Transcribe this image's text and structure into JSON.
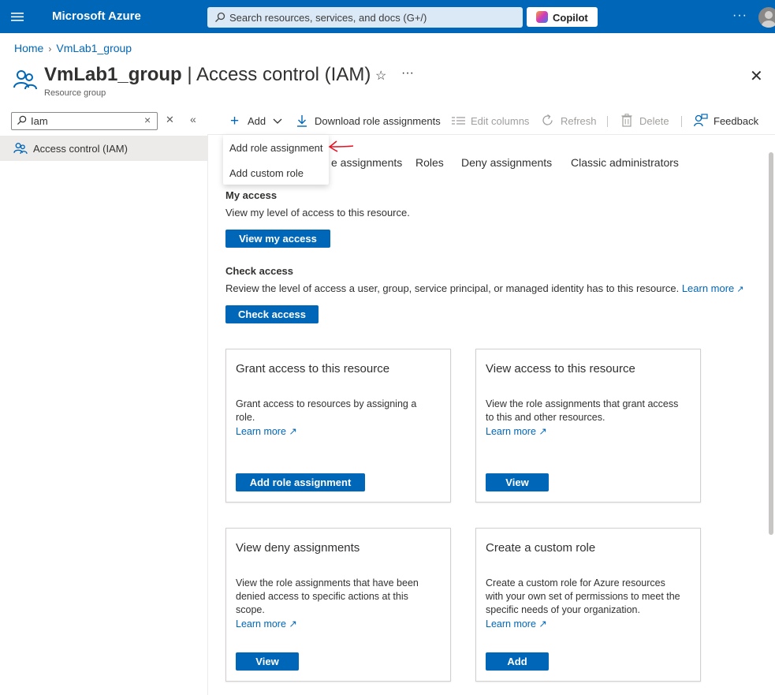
{
  "topbar": {
    "brand": "Microsoft Azure",
    "search_placeholder": "Search resources, services, and docs (G+/)",
    "copilot_label": "Copilot",
    "more": "···"
  },
  "breadcrumb": [
    "Home",
    "VmLab1_group"
  ],
  "page": {
    "resource": "VmLab1_group",
    "section": "Access control (IAM)",
    "separator": "|",
    "subtitle": "Resource group"
  },
  "sidebar": {
    "search_value": "Iam",
    "items": [
      {
        "label": "Access control (IAM)"
      }
    ]
  },
  "toolbar": {
    "add": "Add",
    "download": "Download role assignments",
    "edit_columns": "Edit columns",
    "refresh": "Refresh",
    "delete": "Delete",
    "feedback": "Feedback"
  },
  "dropdown": {
    "items": [
      "Add role assignment",
      "Add custom role"
    ]
  },
  "tabs": {
    "partial": "e assignments",
    "roles": "Roles",
    "deny": "Deny assignments",
    "classic": "Classic administrators"
  },
  "my_access": {
    "title": "My access",
    "desc": "View my level of access to this resource.",
    "button": "View my access"
  },
  "check_access": {
    "title": "Check access",
    "desc": "Review the level of access a user, group, service principal, or managed identity has to this resource.",
    "link": "Learn more",
    "button": "Check access"
  },
  "cards": [
    {
      "title": "Grant access to this resource",
      "desc": "Grant access to resources by assigning a role.",
      "link": "Learn more",
      "button": "Add role assignment"
    },
    {
      "title": "View access to this resource",
      "desc": "View the role assignments that grant access to this and other resources.",
      "link": "Learn more",
      "button": "View"
    },
    {
      "title": "View deny assignments",
      "desc": "View the role assignments that have been denied access to specific actions at this scope.",
      "link": "Learn more",
      "button": "View"
    },
    {
      "title": "Create a custom role",
      "desc": "Create a custom role for Azure resources with your own set of permissions to meet the specific needs of your organization.",
      "link": "Learn more",
      "button": "Add"
    }
  ],
  "colors": {
    "accent": "#0067b8",
    "annotation": "#e81123"
  }
}
